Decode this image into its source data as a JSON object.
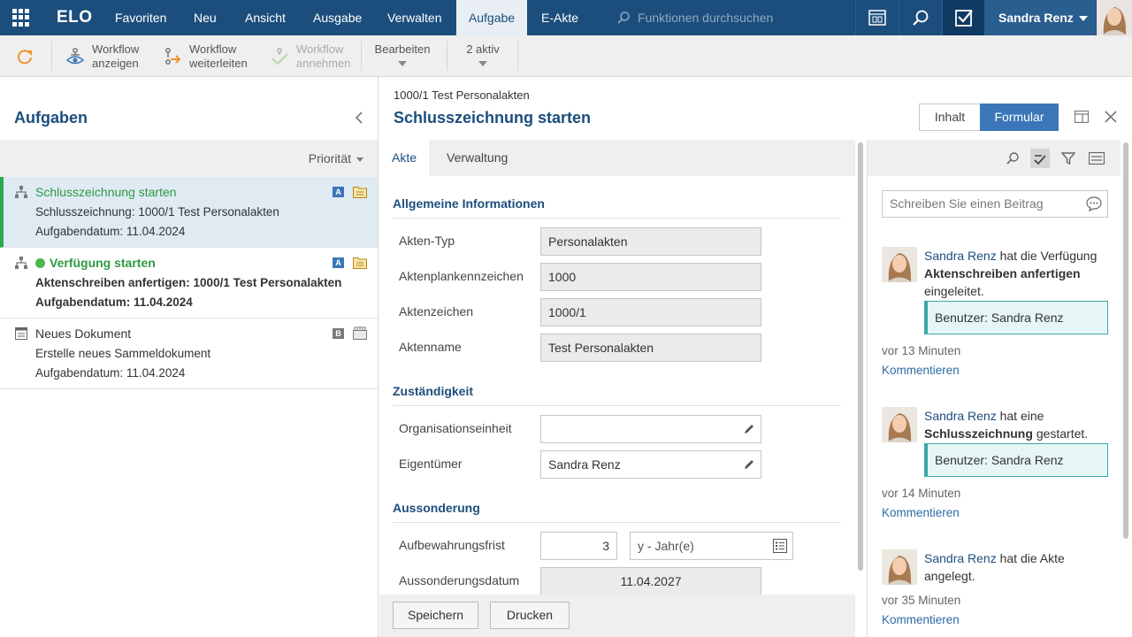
{
  "topnav": {
    "logo": "ELO",
    "menu": [
      "Favoriten",
      "Neu",
      "Ansicht",
      "Ausgabe",
      "Verwalten",
      "Aufgabe",
      "E-Akte"
    ],
    "active_menu": "Aufgabe",
    "search_placeholder": "Funktionen durchsuchen",
    "user_name": "Sandra Renz"
  },
  "toolbar": {
    "workflow_show": [
      "Workflow",
      "anzeigen"
    ],
    "workflow_forward": [
      "Workflow",
      "weiterleiten"
    ],
    "workflow_accept": [
      "Workflow",
      "annehmen"
    ],
    "edit_label": "Bearbeiten",
    "active_label": "2 aktiv"
  },
  "left": {
    "title": "Aufgaben",
    "sort_label": "Priorität",
    "tasks": [
      {
        "title": "Schlusszeichnung starten",
        "line2": "Schlusszeichnung: 1000/1 Test Personalakten",
        "line3": "Aufgabendatum: 11.04.2024",
        "badge": "A"
      },
      {
        "title": "Verfügung starten",
        "line2": "Aktenschreiben anfertigen: 1000/1 Test Personalakten",
        "line3": "Aufgabendatum: 11.04.2024",
        "badge": "A"
      },
      {
        "title": "Neues Dokument",
        "line2": "Erstelle neues Sammeldokument",
        "line3": "Aufgabendatum: 11.04.2024",
        "badge": "B"
      }
    ]
  },
  "main": {
    "breadcrumb": "1000/1 Test Personalakten",
    "title": "Schlusszeichnung starten",
    "view_toggle": {
      "inhalt": "Inhalt",
      "formular": "Formular"
    },
    "tabs": [
      "Akte",
      "Verwaltung"
    ],
    "sections": {
      "general": "Allgemeine Informationen",
      "responsibility": "Zuständigkeit",
      "separation": "Aussonderung"
    },
    "fields": {
      "akten_typ": {
        "label": "Akten-Typ",
        "value": "Personalakten"
      },
      "aktenplan": {
        "label": "Aktenplankennzeichen",
        "value": "1000"
      },
      "aktenzeichen": {
        "label": "Aktenzeichen",
        "value": "1000/1"
      },
      "aktenname": {
        "label": "Aktenname",
        "value": "Test Personalakten"
      },
      "orgeinheit": {
        "label": "Organisationseinheit",
        "value": ""
      },
      "eigentuemer": {
        "label": "Eigentümer",
        "value": "Sandra Renz"
      },
      "aufbewahrung": {
        "label": "Aufbewahrungsfrist",
        "value": "3",
        "unit": "y - Jahr(e)"
      },
      "aussonderungsdatum": {
        "label": "Aussonderungsdatum",
        "value": "11.04.2027"
      }
    },
    "buttons": {
      "save": "Speichern",
      "print": "Drucken"
    }
  },
  "feed": {
    "input_placeholder": "Schreiben Sie einen Beitrag",
    "entries": [
      {
        "name": "Sandra Renz",
        "pre": "hat die Verfügung",
        "bold": "Aktenschreiben anfertigen",
        "post": "eingeleitet.",
        "box": "Benutzer: Sandra Renz",
        "time": "vor 13 Minuten",
        "comment": "Kommentieren"
      },
      {
        "name": "Sandra Renz",
        "pre": "hat eine",
        "bold": "Schlusszeichnung",
        "post": "gestartet.",
        "box": "Benutzer: Sandra Renz",
        "time": "vor 14 Minuten",
        "comment": "Kommentieren"
      },
      {
        "name": "Sandra Renz",
        "pre": "hat die Akte",
        "bold": "",
        "post": "angelegt.",
        "time": "vor 35 Minuten",
        "comment": "Kommentieren"
      }
    ]
  },
  "colors": {
    "nav": "#1c4e7d",
    "accent": "#3b76b9",
    "selected_task": "#dfeaf3",
    "green": "#2fa84f"
  }
}
